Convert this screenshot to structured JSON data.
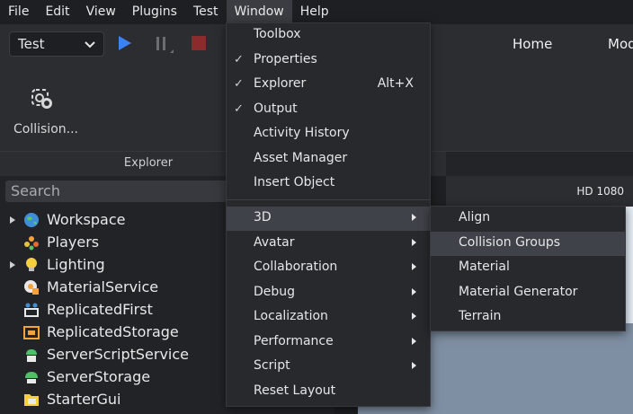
{
  "menubar": {
    "items": [
      "File",
      "Edit",
      "View",
      "Plugins",
      "Test",
      "Window",
      "Help"
    ],
    "active": "Window"
  },
  "toolbar": {
    "mode_select": "Test",
    "tabs": [
      "Home",
      "Model"
    ]
  },
  "ribbon": {
    "collision_label": "Collision..."
  },
  "explorer": {
    "title": "Explorer",
    "search_placeholder": "Search",
    "items": [
      {
        "label": "Workspace",
        "icon": "globe-icon",
        "expandable": true
      },
      {
        "label": "Players",
        "icon": "players-icon",
        "expandable": false
      },
      {
        "label": "Lighting",
        "icon": "lightbulb-icon",
        "expandable": true
      },
      {
        "label": "MaterialService",
        "icon": "material-service-icon",
        "expandable": false
      },
      {
        "label": "ReplicatedFirst",
        "icon": "replicated-first-icon",
        "expandable": false
      },
      {
        "label": "ReplicatedStorage",
        "icon": "replicated-storage-icon",
        "expandable": false
      },
      {
        "label": "ServerScriptService",
        "icon": "server-script-service-icon",
        "expandable": false
      },
      {
        "label": "ServerStorage",
        "icon": "server-storage-icon",
        "expandable": false
      },
      {
        "label": "StarterGui",
        "icon": "starter-gui-icon",
        "expandable": false
      }
    ]
  },
  "viewport": {
    "resolution_label": "HD 1080"
  },
  "window_menu": {
    "items": [
      {
        "label": "Toolbox",
        "checked": false,
        "shortcut": "",
        "submenu": false
      },
      {
        "label": "Properties",
        "checked": true,
        "shortcut": "",
        "submenu": false
      },
      {
        "label": "Explorer",
        "checked": true,
        "shortcut": "Alt+X",
        "submenu": false
      },
      {
        "label": "Output",
        "checked": true,
        "shortcut": "",
        "submenu": false
      },
      {
        "label": "Activity History",
        "checked": false,
        "shortcut": "",
        "submenu": false
      },
      {
        "label": "Asset Manager",
        "checked": false,
        "shortcut": "",
        "submenu": false
      },
      {
        "label": "Insert Object",
        "checked": false,
        "shortcut": "",
        "submenu": false
      },
      {
        "label": "3D",
        "checked": false,
        "shortcut": "",
        "submenu": true,
        "highlighted": true
      },
      {
        "label": "Avatar",
        "checked": false,
        "shortcut": "",
        "submenu": true
      },
      {
        "label": "Collaboration",
        "checked": false,
        "shortcut": "",
        "submenu": true
      },
      {
        "label": "Debug",
        "checked": false,
        "shortcut": "",
        "submenu": true
      },
      {
        "label": "Localization",
        "checked": false,
        "shortcut": "",
        "submenu": true
      },
      {
        "label": "Performance",
        "checked": false,
        "shortcut": "",
        "submenu": true
      },
      {
        "label": "Script",
        "checked": false,
        "shortcut": "",
        "submenu": true
      },
      {
        "label": "Reset Layout",
        "checked": false,
        "shortcut": "",
        "submenu": false
      }
    ]
  },
  "submenu_3d": {
    "items": [
      "Align",
      "Collision Groups",
      "Material",
      "Material Generator",
      "Terrain"
    ],
    "highlighted": "Collision Groups"
  },
  "colors": {
    "play": "#3b82f6",
    "stop": "#8c2b2b",
    "menu_bg": "#27292d",
    "highlight": "#3f4248"
  }
}
